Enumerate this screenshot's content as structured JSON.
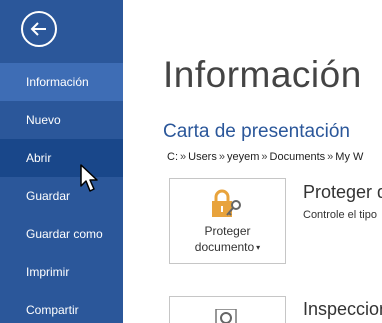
{
  "sidebar": {
    "back_icon": "back-arrow-icon",
    "items": [
      {
        "label": "Información",
        "state": "active"
      },
      {
        "label": "Nuevo",
        "state": "normal"
      },
      {
        "label": "Abrir",
        "state": "hover"
      },
      {
        "label": "Guardar",
        "state": "normal"
      },
      {
        "label": "Guardar como",
        "state": "normal"
      },
      {
        "label": "Imprimir",
        "state": "normal"
      },
      {
        "label": "Compartir",
        "state": "normal"
      }
    ]
  },
  "main": {
    "title": "Información",
    "document_title": "Carta de presentación",
    "path": [
      "C:",
      "Users",
      "yeyem",
      "Documents",
      "My W"
    ],
    "path_separator": "»",
    "protect": {
      "button_line1": "Proteger",
      "button_line2": "documento",
      "title": "Proteger d",
      "description": "Controle el tipo",
      "icon": "lock-key-icon"
    },
    "inspect": {
      "title": "Inspeccion",
      "icon": "inspect-document-icon"
    }
  },
  "colors": {
    "sidebar_bg": "#2b579a",
    "sidebar_active": "#3e6db5",
    "sidebar_hover": "#19478a",
    "accent": "#2b579a",
    "lock": "#e8a33c"
  }
}
